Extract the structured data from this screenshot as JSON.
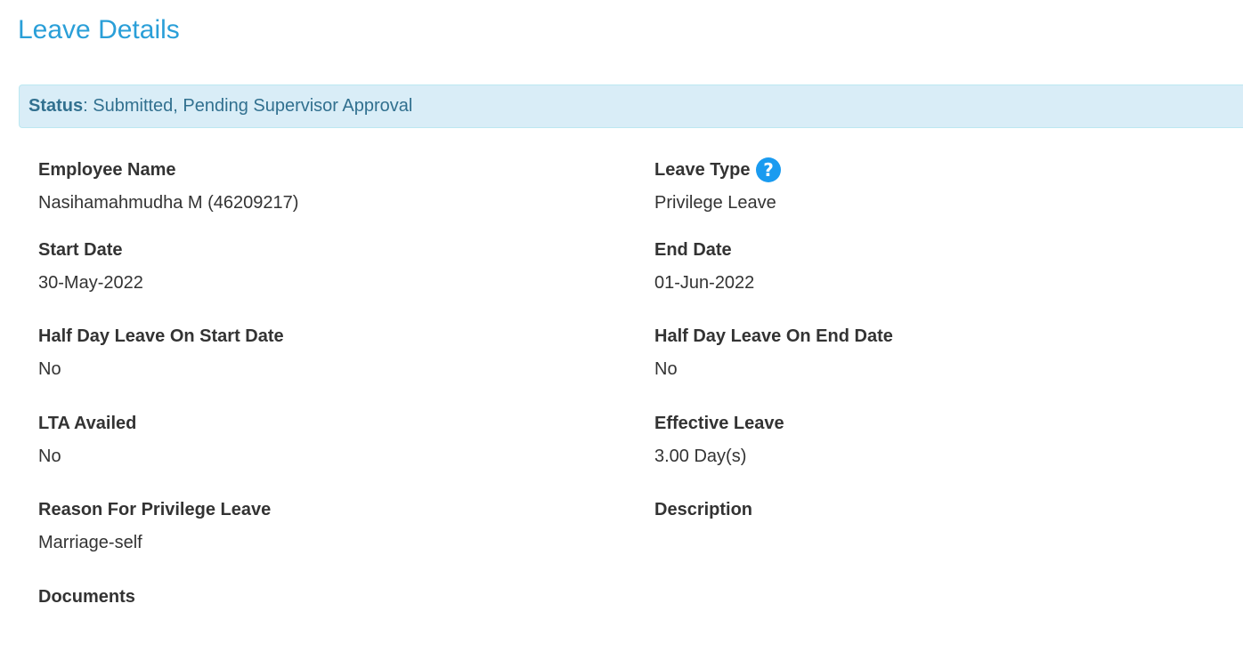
{
  "page": {
    "title": "Leave Details"
  },
  "status": {
    "label": "Status",
    "separator": ": ",
    "text": "Submitted, Pending Supervisor Approval"
  },
  "fields": {
    "employee_name": {
      "label": "Employee Name",
      "value": "Nasihamahmudha M (46209217)"
    },
    "leave_type": {
      "label": "Leave Type",
      "value": "Privilege Leave",
      "icon": "question-circle-icon"
    },
    "start_date": {
      "label": "Start Date",
      "value": "30-May-2022"
    },
    "end_date": {
      "label": "End Date",
      "value": "01-Jun-2022"
    },
    "half_day_start": {
      "label": "Half Day Leave On Start Date",
      "value": "No"
    },
    "half_day_end": {
      "label": "Half Day Leave On End Date",
      "value": "No"
    },
    "lta_availed": {
      "label": "LTA Availed",
      "value": "No"
    },
    "effective_leave": {
      "label": "Effective Leave",
      "value": "3.00 Day(s)"
    },
    "reason": {
      "label": "Reason For Privilege Leave",
      "value": "Marriage-self"
    },
    "description": {
      "label": "Description",
      "value": ""
    },
    "documents": {
      "label": "Documents"
    }
  },
  "colors": {
    "title": "#2a9fd8",
    "status_bg": "#d9edf7",
    "status_border": "#bce8f1",
    "status_text": "#31708f",
    "help_icon": "#1a9bf0",
    "text": "#333333"
  }
}
